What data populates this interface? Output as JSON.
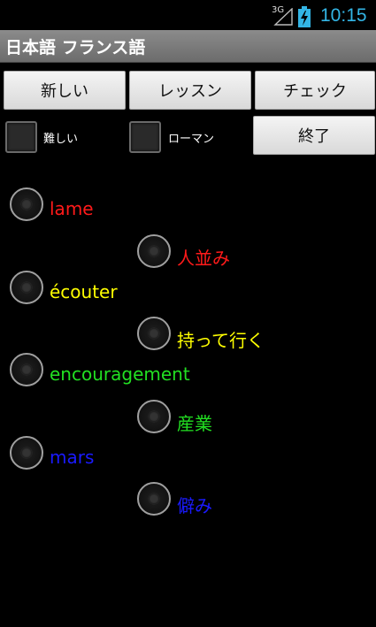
{
  "status_bar": {
    "network": "3G",
    "time": "10:15",
    "time_color": "#33b5e5"
  },
  "app": {
    "title": "日本語 フランス語"
  },
  "toolbar": {
    "new_label": "新しい",
    "lesson_label": "レッスン",
    "check_label": "チェック",
    "end_label": "終了"
  },
  "options": {
    "difficult_label": "難しい",
    "roman_label": "ローマン"
  },
  "quiz": {
    "items": [
      {
        "text": "lame",
        "color": "#ff1a1a"
      },
      {
        "text": "人並み",
        "color": "#ff1a1a"
      },
      {
        "text": "écouter",
        "color": "#ffff00"
      },
      {
        "text": "持って行く",
        "color": "#ffff00"
      },
      {
        "text": "encouragement",
        "color": "#22e022"
      },
      {
        "text": "産業",
        "color": "#22e022"
      },
      {
        "text": "mars",
        "color": "#1a1aff"
      },
      {
        "text": "僻み",
        "color": "#1a1aff"
      }
    ]
  }
}
